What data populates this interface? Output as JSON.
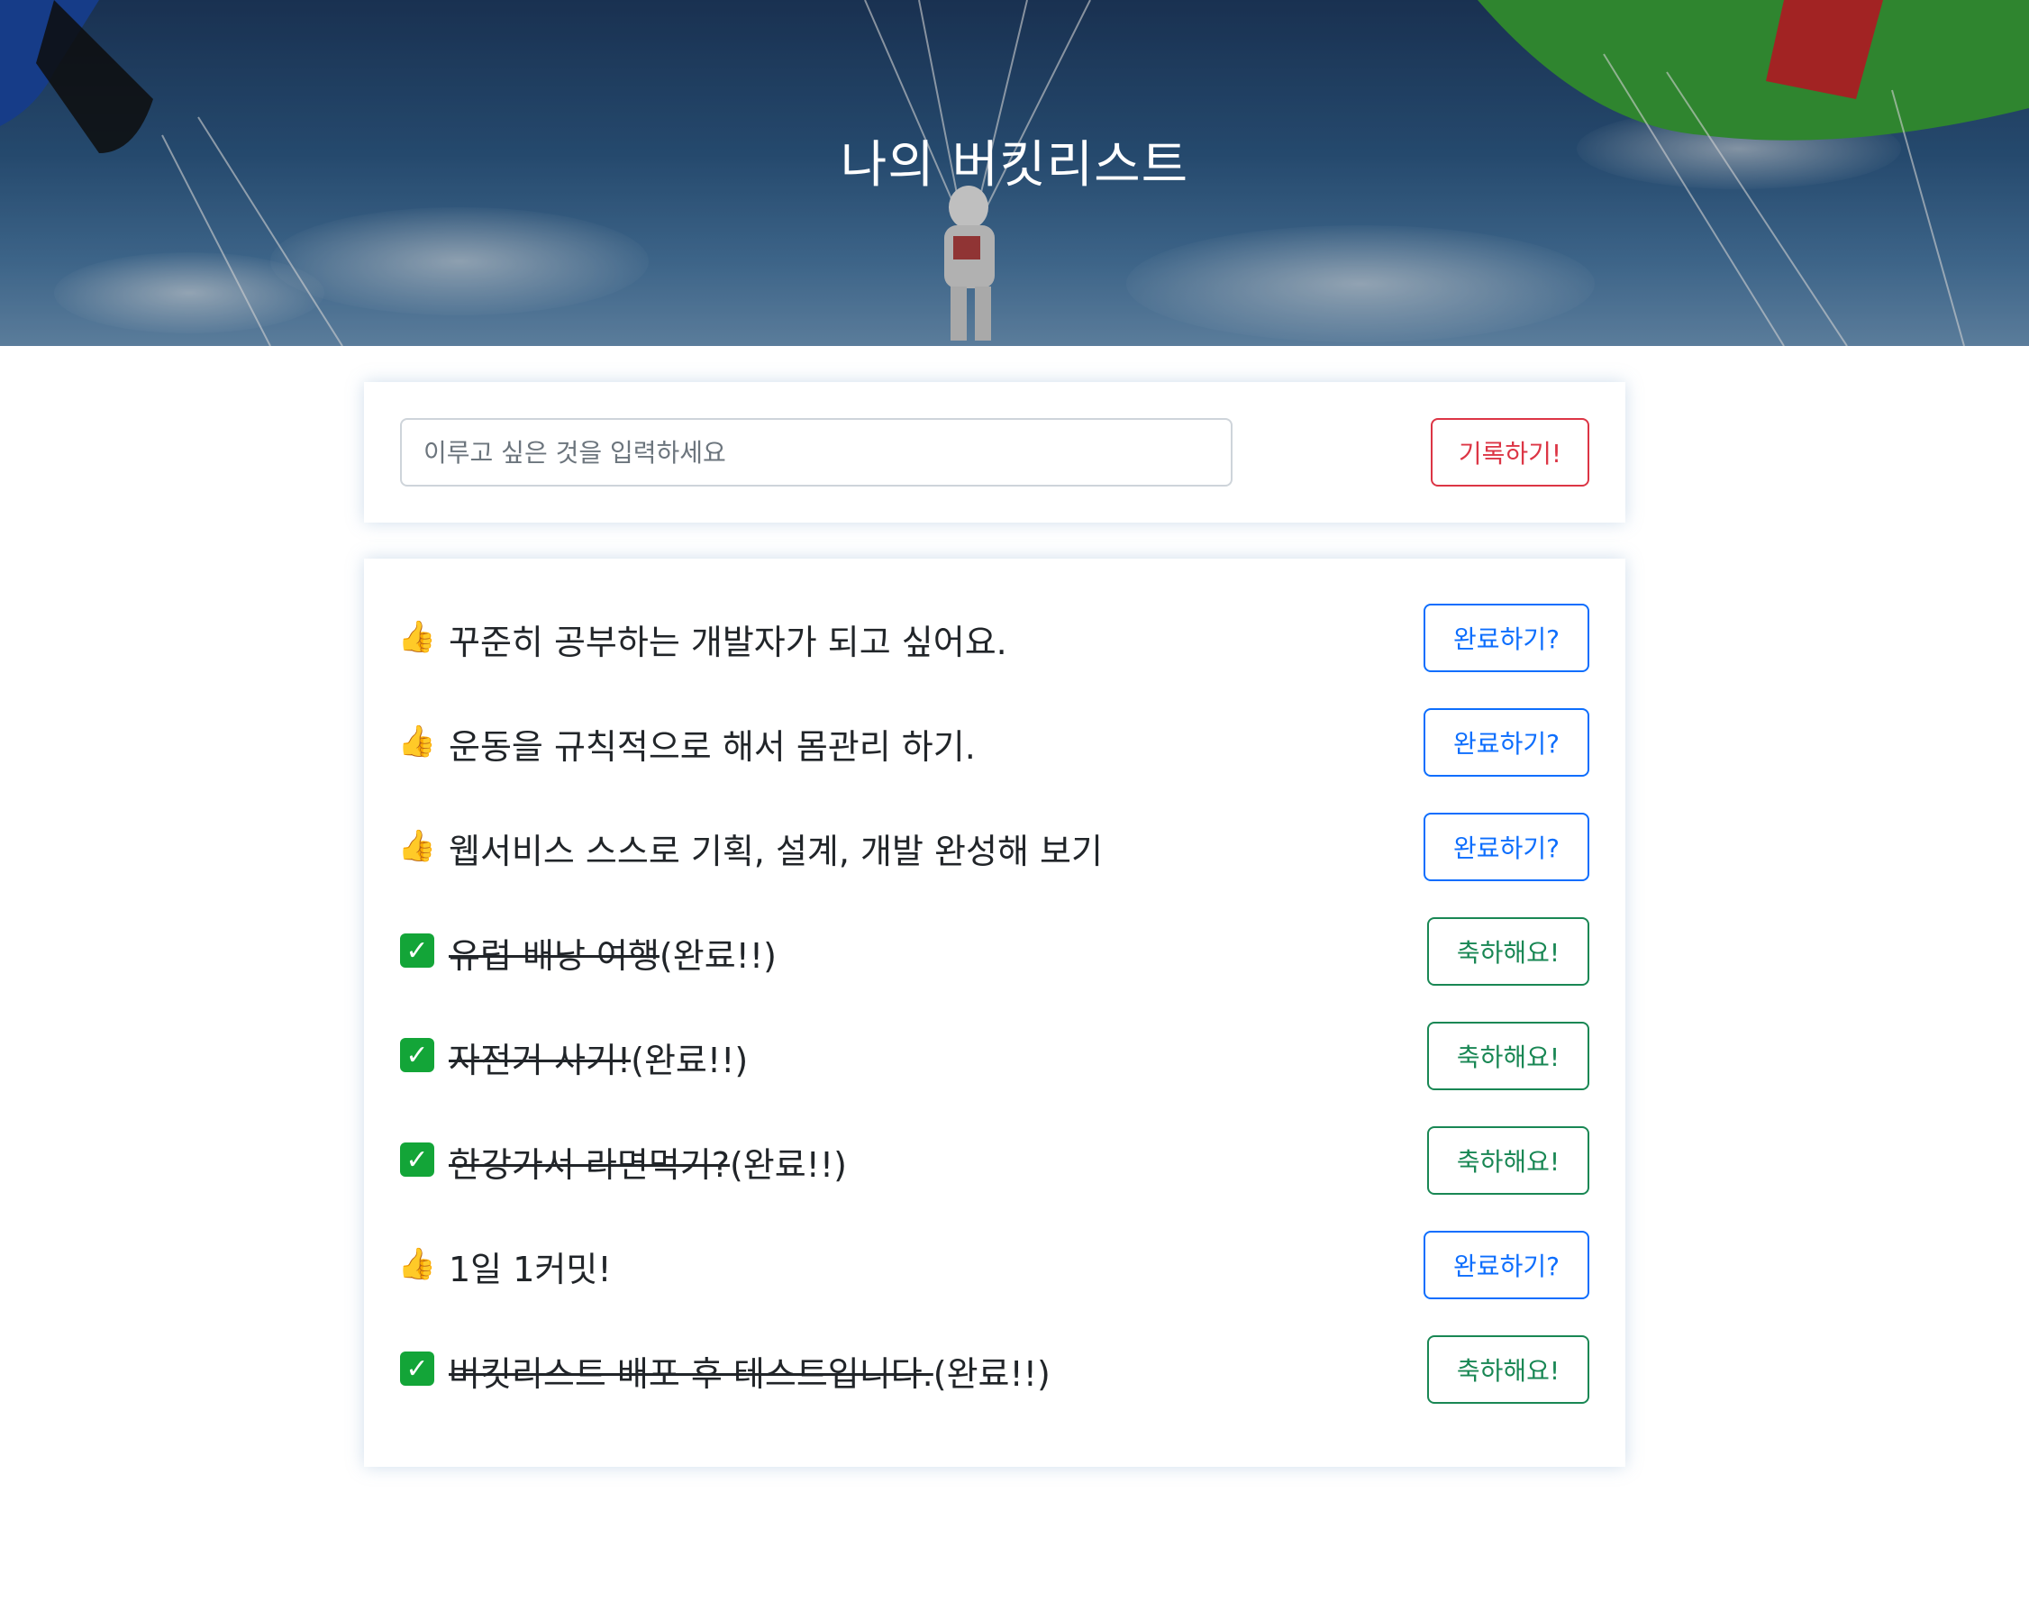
{
  "header": {
    "title": "나의 버킷리스트"
  },
  "input_card": {
    "placeholder": "이루고 싶은 것을 입력하세요",
    "record_button": "기록하기!"
  },
  "colors": {
    "record_button": "#dc3545",
    "done_button": "#0d6efd",
    "congrats_button": "#198754"
  },
  "bucket_list": [
    {
      "icon": "thumbs-up-icon",
      "text": "꾸준히 공부하는 개발자가 되고 싶어요.",
      "completed": false,
      "suffix": "",
      "button": "완료하기?"
    },
    {
      "icon": "thumbs-up-icon",
      "text": "운동을 규칙적으로 해서 몸관리 하기.",
      "completed": false,
      "suffix": "",
      "button": "완료하기?"
    },
    {
      "icon": "thumbs-up-icon",
      "text": "웹서비스 스스로 기획, 설계, 개발 완성해 보기",
      "completed": false,
      "suffix": "",
      "button": "완료하기?"
    },
    {
      "icon": "check-mark-icon",
      "text": "유럽 배낭 여행",
      "completed": true,
      "suffix": "(완료!!)",
      "button": "축하해요!"
    },
    {
      "icon": "check-mark-icon",
      "text": "자전거 사기!",
      "completed": true,
      "suffix": "(완료!!)",
      "button": "축하해요!"
    },
    {
      "icon": "check-mark-icon",
      "text": "한강가서 라면먹기?",
      "completed": true,
      "suffix": "(완료!!)",
      "button": "축하해요!"
    },
    {
      "icon": "thumbs-up-icon",
      "text": "1일 1커밋!",
      "completed": false,
      "suffix": "",
      "button": "완료하기?"
    },
    {
      "icon": "check-mark-icon",
      "text": "버킷리스트 배포 후 테스트입니다.",
      "completed": true,
      "suffix": "(완료!!)",
      "button": "축하해요!"
    }
  ]
}
